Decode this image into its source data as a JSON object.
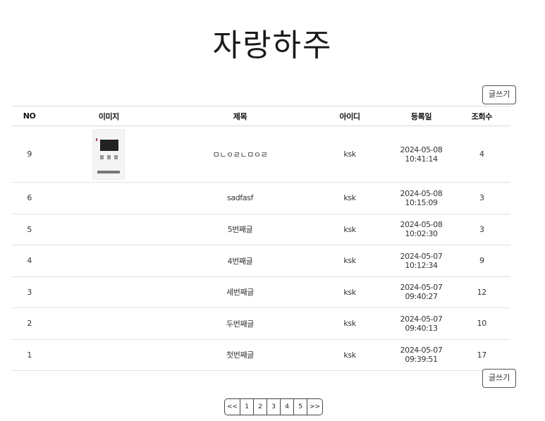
{
  "page": {
    "title": "자랑하주"
  },
  "write_button": {
    "label": "글쓰기"
  },
  "table": {
    "headers": [
      "NO",
      "이미지",
      "제목",
      "아이디",
      "등록일",
      "조회수"
    ],
    "rows": [
      {
        "no": "9",
        "has_image": true,
        "title": "ㅁㄴㅇㄹㄴㅁㅇㄹ",
        "id": "ksk",
        "date": "2024-05-08 10:41:14",
        "views": "4"
      },
      {
        "no": "6",
        "has_image": false,
        "title": "sadfasf",
        "id": "ksk",
        "date": "2024-05-08 10:15:09",
        "views": "3"
      },
      {
        "no": "5",
        "has_image": false,
        "title": "5번째글",
        "id": "ksk",
        "date": "2024-05-08 10:02:30",
        "views": "3"
      },
      {
        "no": "4",
        "has_image": false,
        "title": "4번째글",
        "id": "ksk",
        "date": "2024-05-07 10:12:34",
        "views": "9"
      },
      {
        "no": "3",
        "has_image": false,
        "title": "세번째글",
        "id": "ksk",
        "date": "2024-05-07 09:40:27",
        "views": "12"
      },
      {
        "no": "2",
        "has_image": false,
        "title": "두번째글",
        "id": "ksk",
        "date": "2024-05-07 09:40:13",
        "views": "10"
      },
      {
        "no": "1",
        "has_image": false,
        "title": "첫번째글",
        "id": "ksk",
        "date": "2024-05-07 09:39:51",
        "views": "17"
      }
    ]
  },
  "pagination": {
    "prev": "<<",
    "pages": [
      "1",
      "2",
      "3",
      "4",
      "5"
    ],
    "next": ">>"
  }
}
